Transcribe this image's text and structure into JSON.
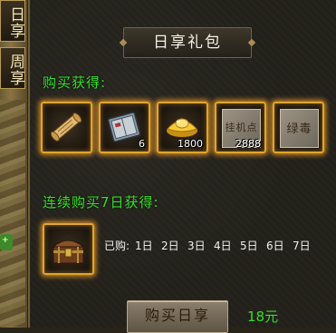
{
  "side_tabs": [
    {
      "label": "日享"
    },
    {
      "label": "周享"
    }
  ],
  "title": "日享礼包",
  "purchase_section": {
    "label": "购买获得:",
    "items": [
      {
        "icon": "scroll-icon",
        "qty": ""
      },
      {
        "icon": "book-icon",
        "qty": "6"
      },
      {
        "icon": "gold-ingot-icon",
        "qty": "1800"
      },
      {
        "icon": "stone-tablet-icon",
        "text": "挂机点",
        "qty": "2888"
      },
      {
        "icon": "stone-tablet-icon",
        "text": "绿毒",
        "qty": ""
      }
    ]
  },
  "streak_section": {
    "label": "连续购买7日获得:",
    "reward_icon": "treasure-chest-icon",
    "bought_label": "已购:",
    "days": [
      "1日",
      "2日",
      "3日",
      "4日",
      "5日",
      "6日",
      "7日"
    ]
  },
  "buy_button": {
    "label": "购买日享"
  },
  "price": "18元",
  "colors": {
    "accent_green": "#33e02a",
    "slot_glow": "#e3a52a"
  }
}
